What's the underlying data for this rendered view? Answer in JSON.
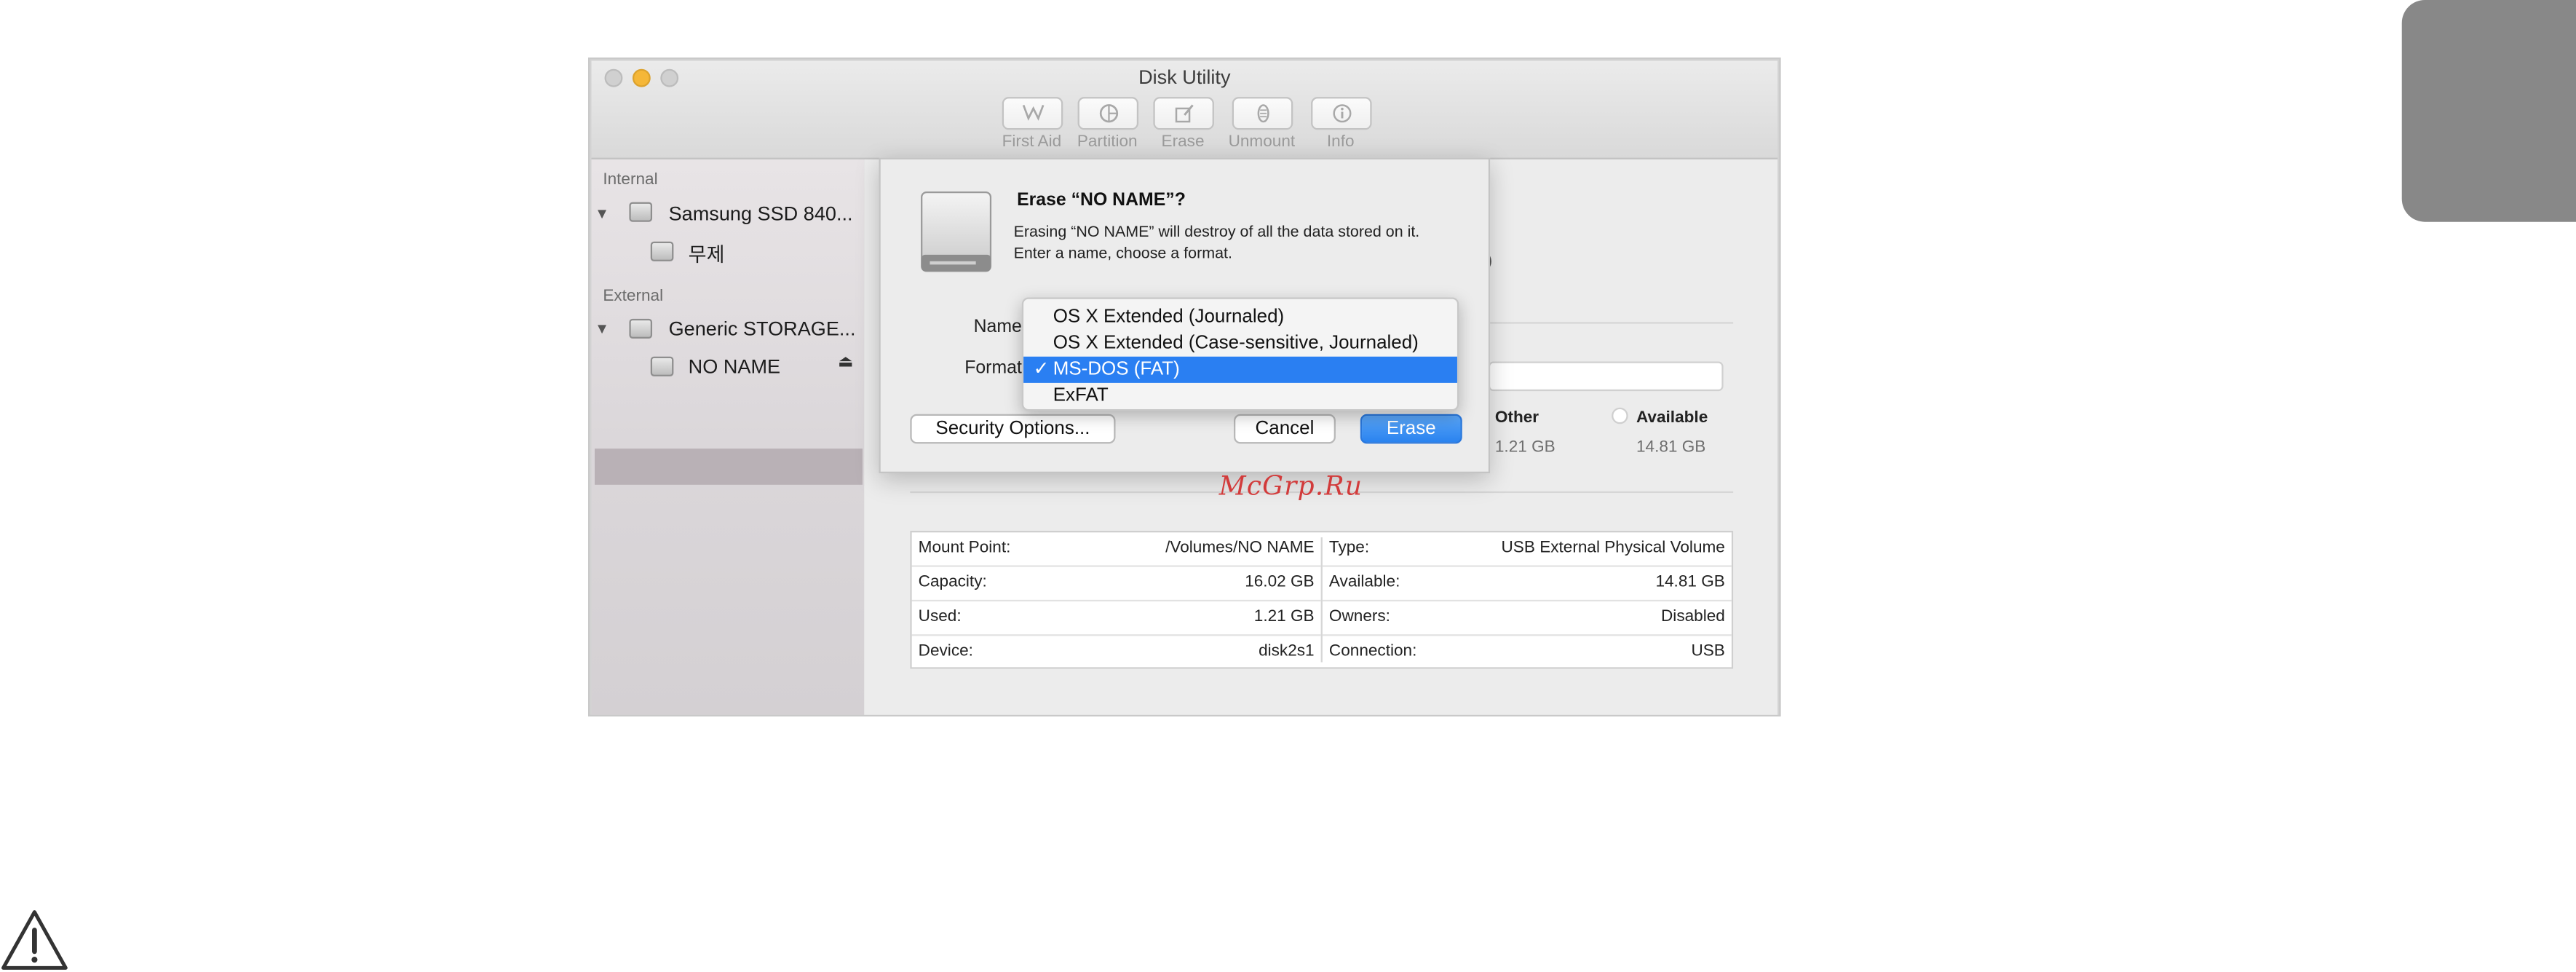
{
  "window": {
    "title": "Disk Utility"
  },
  "toolbar": [
    {
      "label": "First Aid",
      "icon": "stethoscope-icon"
    },
    {
      "label": "Partition",
      "icon": "pie-icon"
    },
    {
      "label": "Erase",
      "icon": "erase-icon"
    },
    {
      "label": "Unmount",
      "icon": "eject-icon"
    },
    {
      "label": "Info",
      "icon": "info-icon"
    }
  ],
  "sidebar": {
    "internal_header": "Internal",
    "external_header": "External",
    "internal_disk": "Samsung SSD 840...",
    "internal_volume": "무제",
    "external_disk": "Generic STORAGE...",
    "external_volume": "NO NAME"
  },
  "background": {
    "partial_text": "T)",
    "legend": [
      {
        "label": "Other",
        "value": "1.21 GB"
      },
      {
        "label": "Available",
        "value": "14.81 GB"
      }
    ],
    "info_left": [
      {
        "key": "Mount Point:",
        "value": "/Volumes/NO NAME"
      },
      {
        "key": "Capacity:",
        "value": "16.02 GB"
      },
      {
        "key": "Used:",
        "value": "1.21 GB"
      },
      {
        "key": "Device:",
        "value": "disk2s1"
      }
    ],
    "info_right": [
      {
        "key": "Type:",
        "value": "USB External Physical Volume"
      },
      {
        "key": "Available:",
        "value": "14.81 GB"
      },
      {
        "key": "Owners:",
        "value": "Disabled"
      },
      {
        "key": "Connection:",
        "value": "USB"
      }
    ]
  },
  "dialog": {
    "title": "Erase “NO NAME”?",
    "message": "Erasing “NO NAME” will destroy of all the data stored on it. Enter a name, choose a format.",
    "name_label": "Name",
    "format_label": "Format",
    "security_button": "Security Options...",
    "cancel_button": "Cancel",
    "erase_button": "Erase"
  },
  "format_menu": {
    "options": [
      "OS X Extended (Journaled)",
      "OS X Extended (Case-sensitive, Journaled)",
      "MS-DOS (FAT)",
      "ExFAT"
    ],
    "selected_index": 2,
    "checkmark": "✓"
  },
  "watermark": "McGrp.Ru",
  "colors": {
    "accent": "#2a7ff2",
    "watermark": "#d23b3b"
  }
}
